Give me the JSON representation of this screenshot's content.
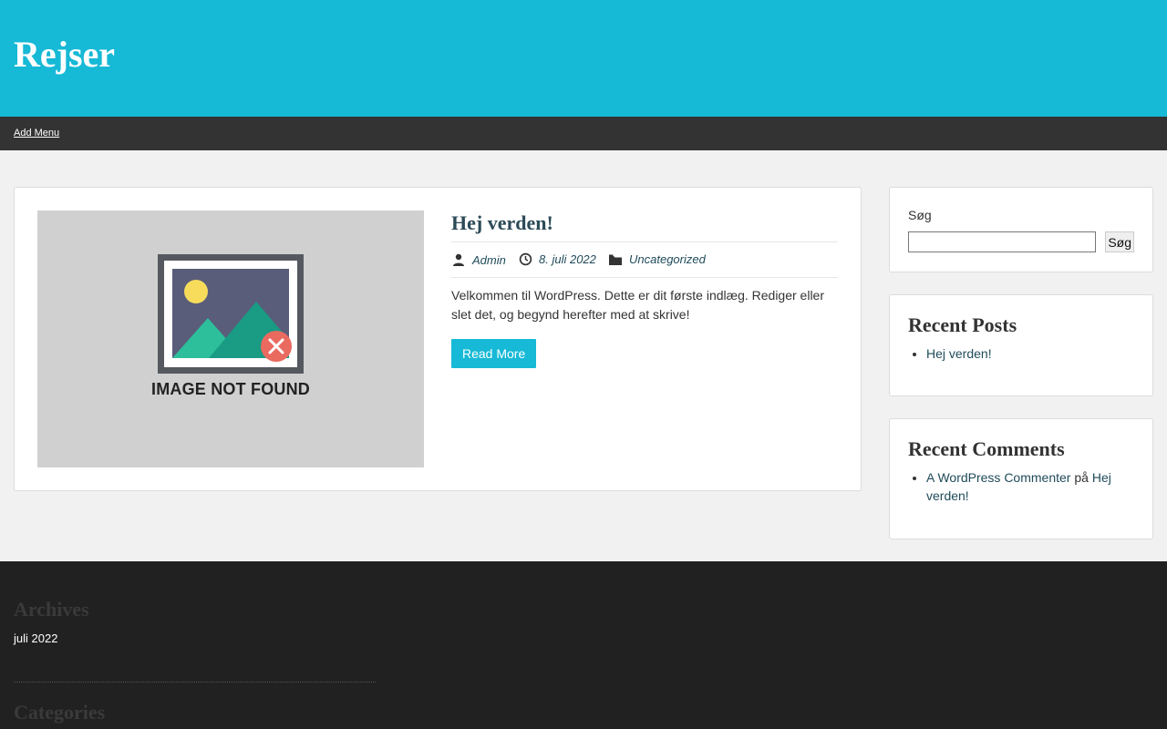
{
  "site": {
    "title": "Rejser"
  },
  "nav": {
    "add_menu_label": "Add Menu"
  },
  "post": {
    "image_placeholder_text": "IMAGE NOT FOUND",
    "title": "Hej verden!",
    "author": "Admin",
    "date": "8. juli 2022",
    "category": "Uncategorized",
    "excerpt": "Velkommen til WordPress. Dette er dit første indlæg. Rediger eller slet det, og begynd herefter med at skrive!",
    "read_more_label": "Read More"
  },
  "sidebar": {
    "search": {
      "label": "Søg",
      "button_label": "Søg",
      "value": ""
    },
    "recent_posts": {
      "title": "Recent Posts",
      "items": [
        "Hej verden!"
      ]
    },
    "recent_comments": {
      "title": "Recent Comments",
      "items": [
        {
          "author": "A WordPress Commenter",
          "connector": "på",
          "post": "Hej verden!"
        }
      ]
    }
  },
  "footer": {
    "archives": {
      "title": "Archives",
      "items": [
        "juli 2022"
      ]
    },
    "categories": {
      "title": "Categories"
    }
  },
  "colors": {
    "brand": "#16b9d6",
    "nav_bg": "#333333",
    "footer_bg": "#212121"
  },
  "icons": {
    "author": "user-icon",
    "date": "clock-icon",
    "category": "folder-icon"
  }
}
